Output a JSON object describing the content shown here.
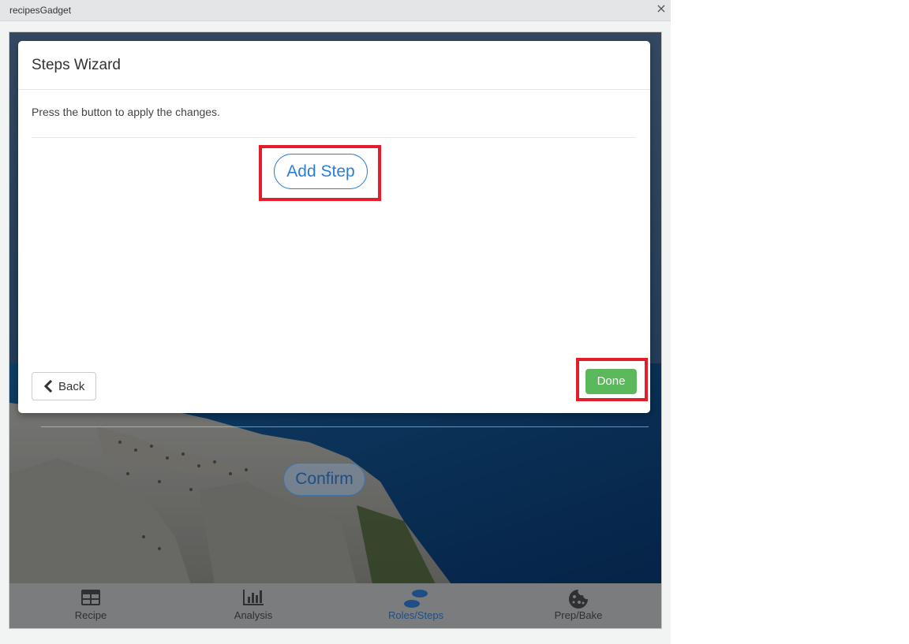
{
  "window": {
    "title": "recipesGadget",
    "close_icon": "×"
  },
  "modal": {
    "title": "Steps Wizard",
    "instruction": "Press the button to apply the changes.",
    "add_step_label": "Add Step",
    "back_label": "Back",
    "done_label": "Done"
  },
  "background": {
    "confirm_label": "Confirm"
  },
  "tabs": [
    {
      "label": "Recipe",
      "icon": "table-icon"
    },
    {
      "label": "Analysis",
      "icon": "bar-chart-icon"
    },
    {
      "label": "Roles/Steps",
      "icon": "footsteps-icon",
      "active": true
    },
    {
      "label": "Prep/Bake",
      "icon": "cookie-icon"
    }
  ],
  "colors": {
    "highlight": "#e41d2b",
    "primary": "#2b7ed6",
    "success": "#5cb85c",
    "active_tab": "#1f4e86"
  }
}
